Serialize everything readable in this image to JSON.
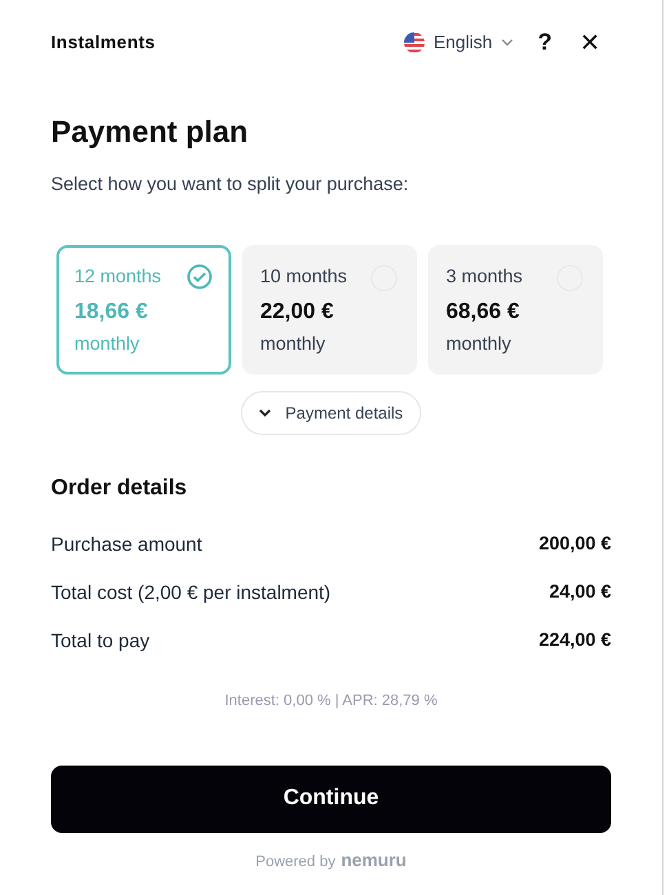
{
  "header": {
    "title": "Instalments",
    "language": "English",
    "help": "?",
    "close": "✕"
  },
  "heading": "Payment plan",
  "subtitle": "Select how you want to split your purchase:",
  "plans": [
    {
      "term": "12 months",
      "amount": "18,66 €",
      "period": "monthly",
      "selected": true
    },
    {
      "term": "10 months",
      "amount": "22,00 €",
      "period": "monthly",
      "selected": false
    },
    {
      "term": "3 months",
      "amount": "68,66 €",
      "period": "monthly",
      "selected": false
    }
  ],
  "details_toggle": {
    "label": "Payment details",
    "expanded": false
  },
  "order": {
    "title": "Order details",
    "rows": [
      {
        "label": "Purchase amount",
        "value": "200,00 €"
      },
      {
        "label": "Total cost (2,00 € per instalment)",
        "value": "24,00 €"
      },
      {
        "label": "Total to pay",
        "value": "224,00 €"
      }
    ]
  },
  "rates": "Interest: 0,00 % | APR: 28,79 %",
  "continue": "Continue",
  "footer": {
    "powered_by": "Powered by",
    "brand": "nemuru"
  }
}
